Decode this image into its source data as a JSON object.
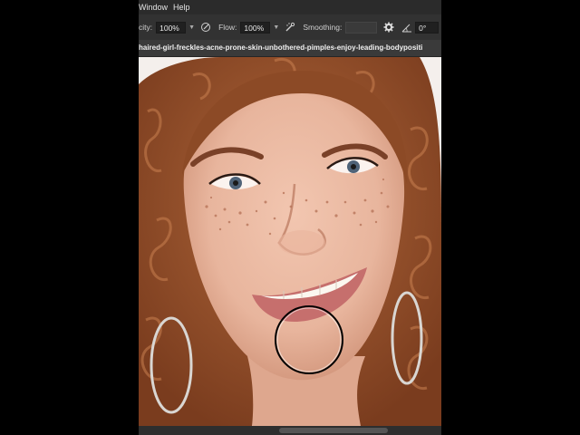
{
  "menubar": {
    "items": [
      "Window",
      "Help"
    ]
  },
  "options": {
    "opacity_label": "city:",
    "opacity_value": "100%",
    "flow_label": "Flow:",
    "flow_value": "100%",
    "smoothing_label": "Smoothing:",
    "smoothing_value": "",
    "angle_value": "0°"
  },
  "document": {
    "tab_title": "haired-girl-freckles-acne-prone-skin-unbothered-pimples-enjoy-leading-bodypositi"
  },
  "colors": {
    "menubar_bg": "#2b2b2b",
    "options_bg": "#323232",
    "workspace_bg": "#535353",
    "hair": "#9a5530",
    "skin": "#eab9a2"
  }
}
